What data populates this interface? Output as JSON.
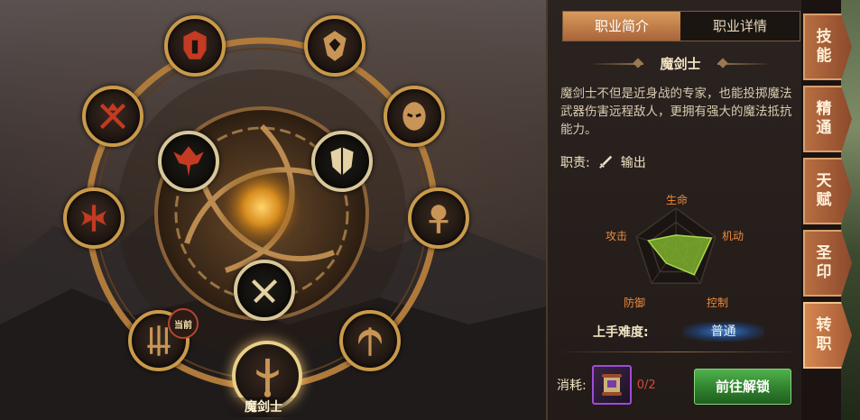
{
  "wheel": {
    "selected_class": "魔剑士",
    "current_badge": "当前",
    "classes": [
      {
        "name": "class-helmet",
        "color": "#c43a22"
      },
      {
        "name": "class-shield-crest",
        "color": "#c89556"
      },
      {
        "name": "class-warrior-mask",
        "color": "#c89556"
      },
      {
        "name": "class-crossed-axes",
        "color": "#c43a22"
      },
      {
        "name": "class-demon-blade",
        "color": "#c43a22"
      },
      {
        "name": "class-knight-shield",
        "color": "#e4d2a4"
      },
      {
        "name": "class-double-axe",
        "color": "#c43a22"
      },
      {
        "name": "class-mace",
        "color": "#c89556"
      },
      {
        "name": "class-crossed-daggers",
        "color": "#e4d2a4"
      },
      {
        "name": "class-triple-swords",
        "color": "#c89556"
      },
      {
        "name": "class-scythe",
        "color": "#c89556"
      },
      {
        "name": "class-magic-sword",
        "color": "#c89556"
      }
    ]
  },
  "panel": {
    "tabs": {
      "intro": "职业简介",
      "detail": "职业详情"
    },
    "class_title": "魔剑士",
    "description": "魔剑士不但是近身战的专家，也能投掷魔法武器伤害远程敌人，更拥有强大的魔法抵抗能力。",
    "role_label": "职责:",
    "role_value": "输出",
    "radar": {
      "axes": [
        "生命",
        "机动",
        "控制",
        "防御",
        "攻击"
      ],
      "values": [
        0.35,
        0.9,
        0.75,
        0.4,
        0.7
      ],
      "fill_color": "#7fb22e"
    },
    "difficulty_label": "上手难度:",
    "difficulty_value": "普通",
    "cost_label": "消耗:",
    "cost_count": "0/2",
    "unlock_button": "前往解锁"
  },
  "side_tabs": [
    "技能",
    "精通",
    "天赋",
    "圣印",
    "转职"
  ],
  "active_side_tab": "转职"
}
